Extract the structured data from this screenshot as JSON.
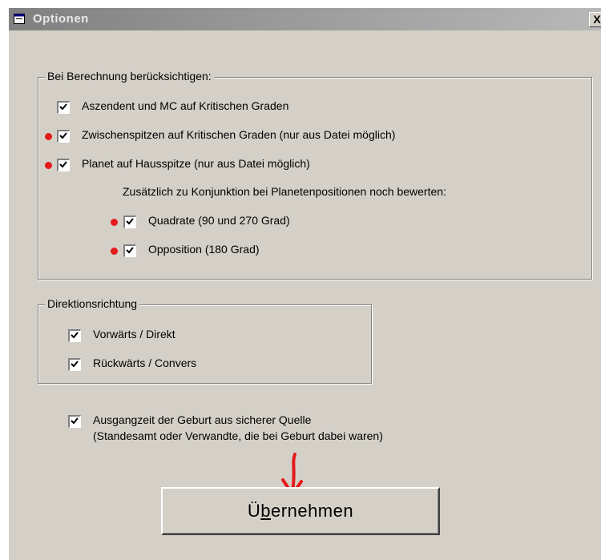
{
  "window": {
    "title": "Optionen",
    "close_label": "X"
  },
  "group_calc": {
    "legend": "Bei Berechnung berücksichtigen:",
    "options": [
      {
        "label": "Aszendent und MC auf Kritischen Graden",
        "checked": true,
        "marked": false
      },
      {
        "label": "Zwischenspitzen auf Kritischen Graden (nur aus Datei möglich)",
        "checked": true,
        "marked": true
      },
      {
        "label": "Planet auf Hausspitze (nur aus Datei möglich)",
        "checked": true,
        "marked": true
      }
    ],
    "note": "Zusätzlich zu Konjunktion bei Planetenpositionen noch bewerten:",
    "sub_options": [
      {
        "label": "Quadrate (90 und 270 Grad)",
        "checked": true,
        "marked": true
      },
      {
        "label": "Opposition (180 Grad)",
        "checked": true,
        "marked": true
      }
    ]
  },
  "group_direction": {
    "legend": "Direktionsrichtung",
    "options": [
      {
        "label": "Vorwärts / Direkt",
        "checked": true
      },
      {
        "label": "Rückwärts / Convers",
        "checked": true
      }
    ]
  },
  "birth_time": {
    "line1": "Ausgangzeit der Geburt aus sicherer Quelle",
    "line2": "(Standesamt oder Verwandte, die bei Geburt dabei waren)",
    "checked": true
  },
  "apply_button": {
    "prefix": "Ü",
    "mnemonic": "b",
    "suffix": "ernehmen"
  },
  "colors": {
    "face": "#d4d0c8",
    "annotation": "#e41b1b",
    "titlebar": "#808080"
  }
}
